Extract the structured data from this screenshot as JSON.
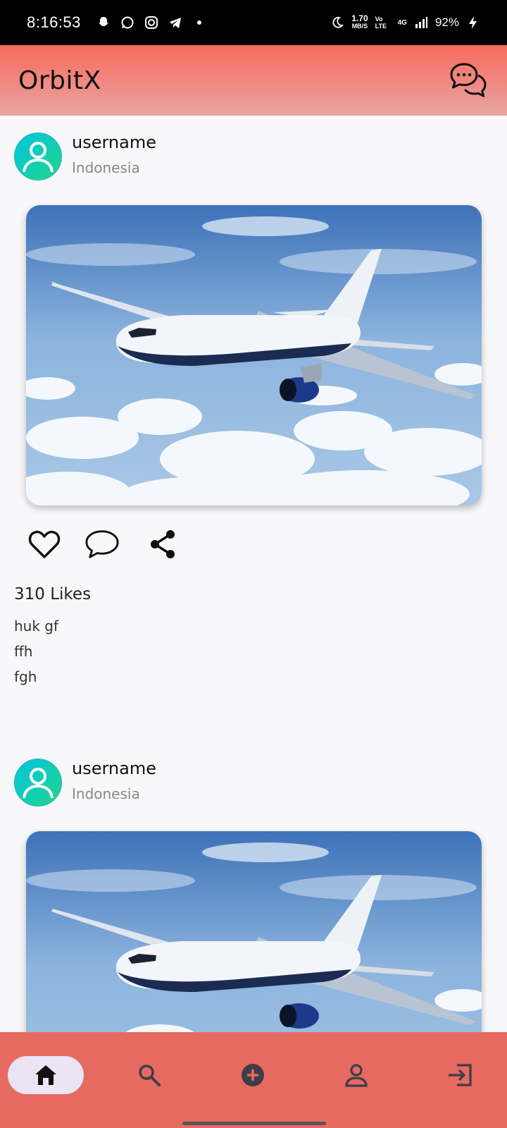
{
  "status_bar": {
    "time": "8:16:53",
    "speed": "1.70",
    "speed_unit": "MB/S",
    "volte": "Vo LTE",
    "network": "4G",
    "battery": "92%"
  },
  "app_bar": {
    "title": "OrbitX",
    "chat_icon": "chat-bubbles-icon"
  },
  "posts": [
    {
      "username": "username",
      "location": "Indonesia",
      "likes": "310 Likes",
      "caption": [
        "huk gf",
        "ffh",
        "fgh"
      ]
    },
    {
      "username": "username",
      "location": "Indonesia"
    }
  ],
  "bottom_nav": {
    "items": [
      "home-icon",
      "search-icon",
      "add-circle-icon",
      "profile-icon",
      "logout-icon"
    ],
    "active": "home-icon"
  },
  "colors": {
    "app_bar_top": "#f86a5c",
    "app_bar_bottom": "#e8a5a3",
    "bottom_nav": "#e76a61",
    "active_pill": "#ece3f5",
    "nav_icon": "#3d3d4a"
  }
}
